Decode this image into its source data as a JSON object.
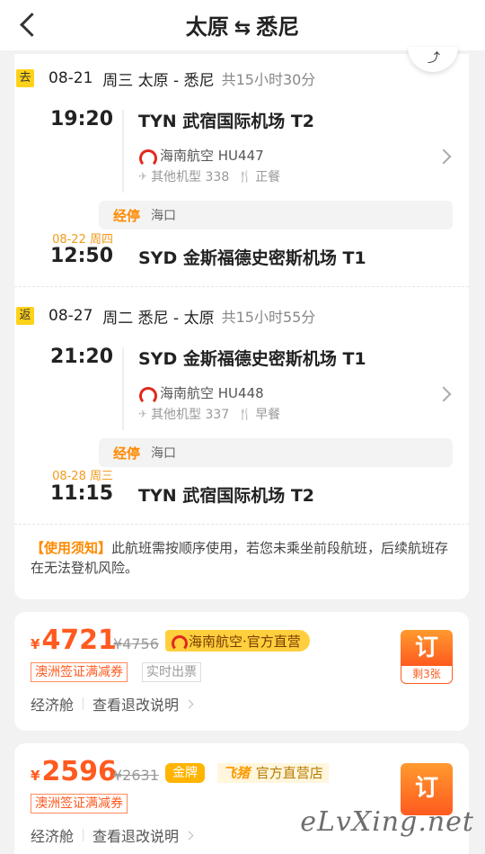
{
  "header": {
    "from": "太原",
    "swap_icon": "⇆",
    "to": "悉尼"
  },
  "outbound": {
    "tag": "去",
    "date": "08-21",
    "weekday": "周三",
    "route": "太原 - 悉尼",
    "duration": "共15小时30分",
    "dep_time": "19:20",
    "dep_airport": "TYN 武宿国际机场 T2",
    "airline": "海南航空 HU447",
    "aircraft": "其他机型 338",
    "meal": "正餐",
    "stop_label": "经停",
    "stop_city": "海口",
    "arr_date": "08-22 周四",
    "arr_time": "12:50",
    "arr_airport": "SYD 金斯福德史密斯机场 T1"
  },
  "return": {
    "tag": "返",
    "date": "08-27",
    "weekday": "周二",
    "route": "悉尼 - 太原",
    "duration": "共15小时55分",
    "dep_time": "21:20",
    "dep_airport": "SYD 金斯福德史密斯机场 T1",
    "airline": "海南航空 HU448",
    "aircraft": "其他机型 337",
    "meal": "早餐",
    "stop_label": "经停",
    "stop_city": "海口",
    "arr_date": "08-28 周三",
    "arr_time": "11:15",
    "arr_airport": "TYN 武宿国际机场 T2"
  },
  "notice": {
    "label": "【使用须知】",
    "text": "此航班需按顺序使用，若您未乘坐前段航班，后续航班存在无法登机风险。"
  },
  "offers": [
    {
      "currency": "¥",
      "price": "4721",
      "original": "¥4756",
      "brand": "海南航空·官方直营",
      "tags": [
        "澳洲签证满减券",
        "实时出票"
      ],
      "cabin": "经济舱",
      "refund_link": "查看退改说明",
      "book": "订",
      "remaining": "剩3张"
    },
    {
      "currency": "¥",
      "price": "2596",
      "original": "¥2631",
      "gold": "金牌",
      "shop_logo": "飞猪",
      "shop": "官方直营店",
      "tags": [
        "澳洲签证满减券"
      ],
      "cabin": "经济舱",
      "refund_link": "查看退改说明",
      "book": "订"
    }
  ],
  "watermark": "eLvXing.net",
  "colors": {
    "accent": "#ff5a1f",
    "tag_yellow": "#ffd21a",
    "stop_orange": "#ff8a00"
  }
}
